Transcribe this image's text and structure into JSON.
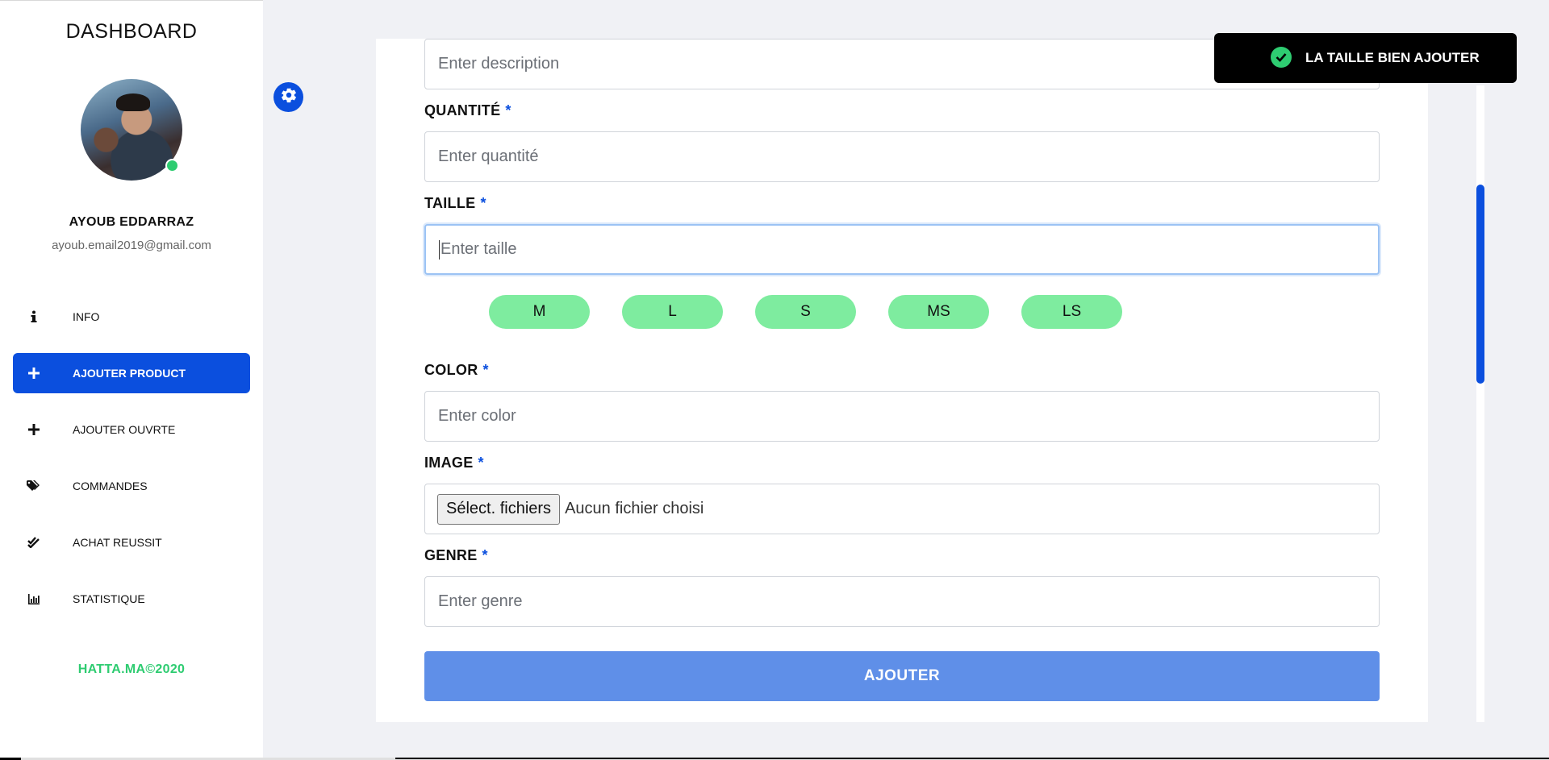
{
  "sidebar": {
    "brand": "DASHBOARD",
    "user_name": "AYOUB EDDARRAZ",
    "user_email": "ayoub.email2019@gmail.com",
    "items": [
      {
        "label": "INFO",
        "icon": "info-icon",
        "glyph": "i"
      },
      {
        "label": "AJOUTER PRODUCT",
        "icon": "plus-icon",
        "glyph": "+",
        "active": true
      },
      {
        "label": "AJOUTER OUVRTE",
        "icon": "plus-icon",
        "glyph": "+"
      },
      {
        "label": "COMMANDES",
        "icon": "tags-icon",
        "glyph": "⬥"
      },
      {
        "label": "ACHAT REUSSIT",
        "icon": "double-check-icon",
        "glyph": "✔"
      },
      {
        "label": "STATISTIQUE",
        "icon": "chart-icon",
        "glyph": "▥"
      }
    ],
    "footer": "HATTA.MA©2020",
    "accent": "#0b4fde",
    "online_color": "#2ecc71"
  },
  "form": {
    "description_placeholder": "Enter description",
    "quantite_label": "QUANTITÉ",
    "quantite_placeholder": "Enter quantité",
    "taille_label": "TAILLE",
    "taille_placeholder": "Enter taille",
    "sizes": [
      "M",
      "L",
      "S",
      "MS",
      "LS"
    ],
    "color_label": "COLOR",
    "color_placeholder": "Enter color",
    "image_label": "IMAGE",
    "file_button": "Sélect. fichiers",
    "file_status": "Aucun fichier choisi",
    "genre_label": "GENRE",
    "genre_placeholder": "Enter genre",
    "required_mark": "*",
    "submit_label": "AJOUTER",
    "chip_color": "#7eec9f",
    "submit_color": "#5f8fe8"
  },
  "toast": {
    "message": "LA TAILLE BIEN AJOUTER",
    "icon": "check-circle-icon"
  },
  "settings": {
    "icon": "gear-icon"
  }
}
